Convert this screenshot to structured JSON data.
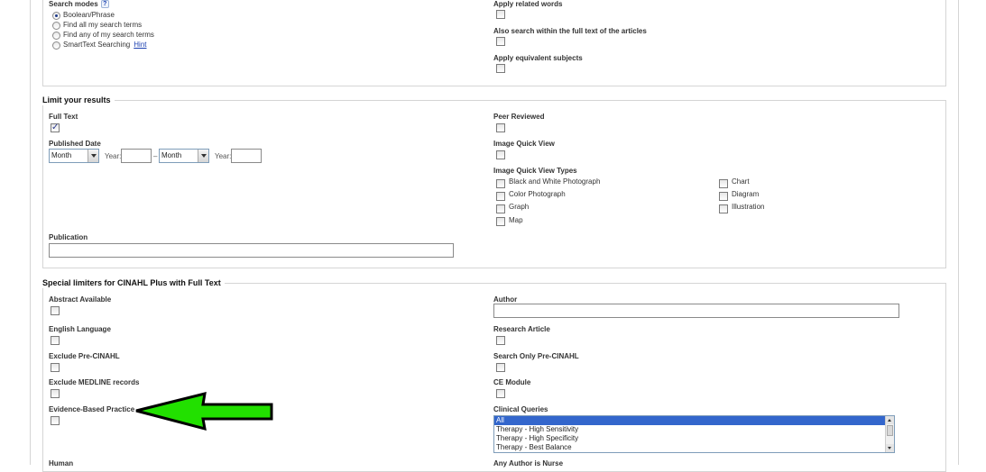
{
  "search_options": {
    "search_modes_label": "Search modes",
    "help_glyph": "?",
    "modes": [
      "Boolean/Phrase",
      "Find all my search terms",
      "Find any of my search terms",
      "SmartText Searching"
    ],
    "selected_mode": "Boolean/Phrase",
    "hint_link": "Hint",
    "apply_related_words": "Apply related words",
    "search_full_text": "Also search within the full text of the articles",
    "apply_equivalent_subjects": "Apply equivalent subjects"
  },
  "limit_results": {
    "title": "Limit your results",
    "full_text": "Full Text",
    "full_text_checked": true,
    "peer_reviewed": "Peer Reviewed",
    "published_date": "Published Date",
    "month_value": "Month",
    "year_label": "Year:",
    "dash": "–",
    "image_quick_view": "Image Quick View",
    "image_quick_view_types": "Image Quick View Types",
    "types_col1": [
      "Black and White Photograph",
      "Color Photograph",
      "Graph",
      "Map"
    ],
    "types_col2": [
      "Chart",
      "Diagram",
      "Illustration"
    ],
    "publication": "Publication"
  },
  "special_limiters": {
    "title": "Special limiters for CINAHL Plus with Full Text",
    "abstract_available": "Abstract Available",
    "english_language": "English Language",
    "exclude_pre_cinahl": "Exclude Pre-CINAHL",
    "exclude_medline": "Exclude MEDLINE records",
    "evidence_based": "Evidence-Based Practice",
    "human": "Human",
    "author": "Author",
    "research_article": "Research Article",
    "search_only_pre_cinahl": "Search Only Pre-CINAHL",
    "ce_module": "CE Module",
    "clinical_queries": "Clinical Queries",
    "clinical_options": [
      "All",
      "Therapy - High Sensitivity",
      "Therapy - High Specificity",
      "Therapy - Best Balance"
    ],
    "clinical_selected": "All",
    "any_author_nurse": "Any Author is Nurse"
  },
  "annotation": {
    "arrow_color": "#22e000",
    "arrow_outline": "#000000"
  }
}
